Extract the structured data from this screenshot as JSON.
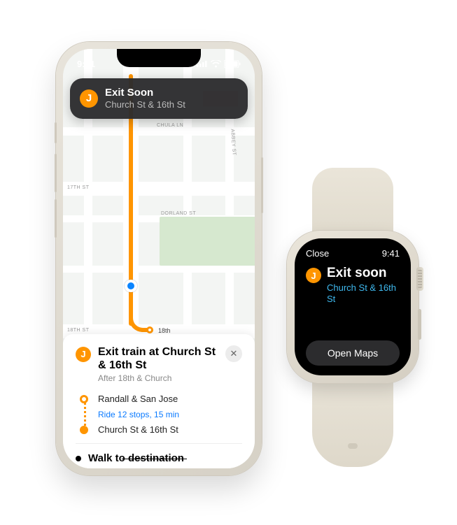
{
  "phone": {
    "status_time": "9:41",
    "banner": {
      "line_letter": "J",
      "title": "Exit Soon",
      "subtitle": "Church St & 16th St"
    },
    "map": {
      "labels": {
        "chula": "CHULA LN",
        "abbey": "ABBEY ST",
        "seventeenth": "17TH ST",
        "dorland": "DORLAND ST",
        "eighteenth": "18TH ST"
      },
      "route_end_label": "18th"
    },
    "sheet": {
      "line_letter": "J",
      "title": "Exit train at Church St & 16th St",
      "subtitle": "After 18th & Church",
      "close_glyph": "✕",
      "stop_start": "Randall & San Jose",
      "ride_info": "Ride 12 stops, 15 min",
      "stop_end": "Church St & 16th St",
      "walk": "Walk to destination"
    }
  },
  "watch": {
    "close": "Close",
    "time": "9:41",
    "line_letter": "J",
    "title": "Exit soon",
    "subtitle": "Church St & 16th St",
    "button": "Open Maps"
  }
}
